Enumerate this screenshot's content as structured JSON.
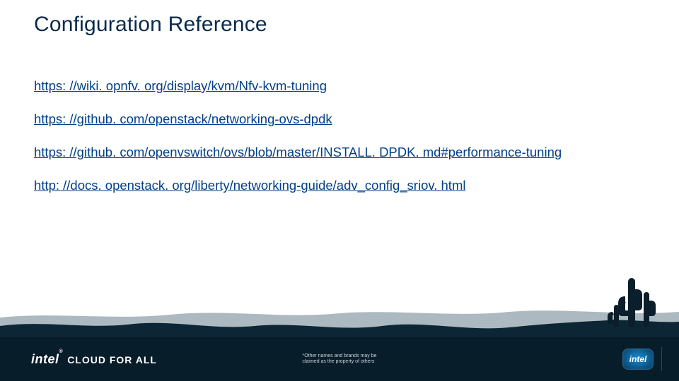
{
  "title": "Configuration Reference",
  "links": [
    {
      "text": "https: //wiki. opnfv. org/display/kvm/Nfv-kvm-tuning",
      "href": "https://wiki.opnfv.org/display/kvm/Nfv-kvm-tuning"
    },
    {
      "text": "https: //github. com/openstack/networking-ovs-dpdk",
      "href": "https://github.com/openstack/networking-ovs-dpdk"
    },
    {
      "text": "https: //github. com/openvswitch/ovs/blob/master/INSTALL. DPDK. md#performance-tuning",
      "href": "https://github.com/openvswitch/ovs/blob/master/INSTALL.DPDK.md#performance-tuning"
    },
    {
      "text": "http: //docs. openstack. org/liberty/networking-guide/adv_config_sriov. html",
      "href": "http://docs.openstack.org/liberty/networking-guide/adv_config_sriov.html"
    }
  ],
  "footer": {
    "brand_intel": "intel",
    "brand_reg": "®",
    "brand_tagline": "CLOUD FOR ALL",
    "disclaimer": "*Other names and brands may be\nclaimed as the property of others",
    "chip_label": "intel"
  }
}
